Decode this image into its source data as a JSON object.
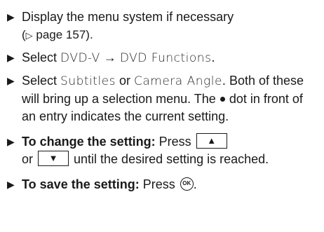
{
  "steps": [
    {
      "text_a": "Display the menu system if necessary",
      "text_b": "(",
      "page_ref_icon": "▷",
      "text_c": " page 157)."
    },
    {
      "text_a": "Select ",
      "code_a": "DVD-V",
      "arrow": "→",
      "code_b": "DVD Functions",
      "text_b": "."
    },
    {
      "text_a": "Select ",
      "code_a": "Subtitles",
      "text_b": " or ",
      "code_b": "Camera Angle",
      "text_c": ".",
      "text_d": "Both of these will bring up a selection menu. The",
      "text_e": "dot in front of an entry indicates the current setting."
    },
    {
      "bold": "To change the setting:",
      "text_a": " Press ",
      "key_up": "▲",
      "text_b": "or ",
      "key_down": "▼",
      "text_c": " until the desired setting is reached."
    },
    {
      "bold": "To save the setting:",
      "text_a": " Press ",
      "ok_label": "OK",
      "text_b": "."
    }
  ],
  "bullet_glyph": "▶",
  "icons": {
    "page_ref": "triangle-right-outline-icon",
    "current_setting_dot": "filled-dot-icon",
    "key_up": "up-arrow-key-icon",
    "key_down": "down-arrow-key-icon",
    "ok_button": "ok-button-icon"
  }
}
